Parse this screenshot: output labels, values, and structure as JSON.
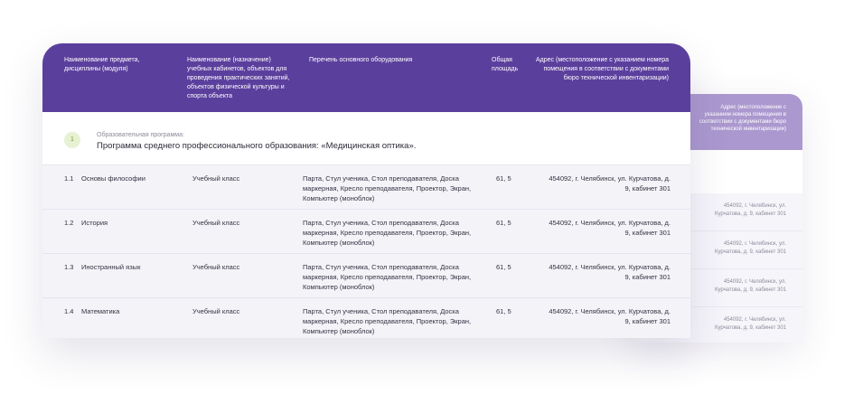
{
  "back_card": {
    "header_address": "Адрес (местоположение с указанием номера помещения в соответствии с документами бюро технической инвентаризации)",
    "rows": [
      {
        "address": "454092, г. Челябинск, ул. Курчатова, д. 9, кабинет 301"
      },
      {
        "address": "454092, г. Челябинск, ул. Курчатова, д. 9, кабинет 301"
      },
      {
        "address": "454092, г. Челябинск, ул. Курчатова, д. 9, кабинет 301"
      },
      {
        "address": "454092, г. Челябинск, ул. Курчатова, д. 9, кабинет 301"
      }
    ]
  },
  "table": {
    "headers": {
      "subject": "Наименование предмета, дисциплины (модуля)",
      "room": "Наименование (назначение) учебных кабинетов, объектов для проведения практических занятий, объектов физической культуры и спорта объекта",
      "equipment": "Перечень основного оборудования",
      "area": "Общая площадь",
      "address": "Адрес (местоположение с указанием номера помещения в соответствии с документами бюро технической инвентаризации)"
    },
    "program": {
      "badge": "1",
      "caption": "Образовательная программа:",
      "name": "Программа среднего профессионального образования: «Медицинская оптика»."
    },
    "rows": [
      {
        "num": "1.1",
        "subject": "Основы философии",
        "room": "Учебный класс",
        "equipment": "Парта, Стул ученика, Стол преподавателя, Доска маркерная, Кресло преподавателя, Проектор, Экран, Компьютер (моноблок)",
        "area": "61, 5",
        "address": "454092, г. Челябинск, ул. Курчатова, д. 9, кабинет 301"
      },
      {
        "num": "1.2",
        "subject": "История",
        "room": "Учебный класс",
        "equipment": "Парта, Стул ученика, Стол преподавателя, Доска маркерная, Кресло преподавателя, Проектор, Экран, Компьютер (моноблок)",
        "area": "61, 5",
        "address": "454092, г. Челябинск, ул. Курчатова, д. 9, кабинет 301"
      },
      {
        "num": "1.3",
        "subject": "Иностранный язык",
        "room": "Учебный класс",
        "equipment": "Парта, Стул ученика, Стол преподавателя, Доска маркерная, Кресло преподавателя, Проектор, Экран, Компьютер (моноблок)",
        "area": "61, 5",
        "address": "454092, г. Челябинск, ул. Курчатова, д. 9, кабинет 301"
      },
      {
        "num": "1.4",
        "subject": "Математика",
        "room": "Учебный класс",
        "equipment": "Парта, Стул ученика, Стол преподавателя, Доска маркерная, Кресло преподавателя, Проектор, Экран, Компьютер (моноблок)",
        "area": "61, 5",
        "address": "454092, г. Челябинск, ул. Курчатова, д. 9, кабинет 301"
      }
    ]
  },
  "colors": {
    "header": "#5b3f9d",
    "back_header": "#ab98cf",
    "badge_bg": "#e6f2d1"
  }
}
